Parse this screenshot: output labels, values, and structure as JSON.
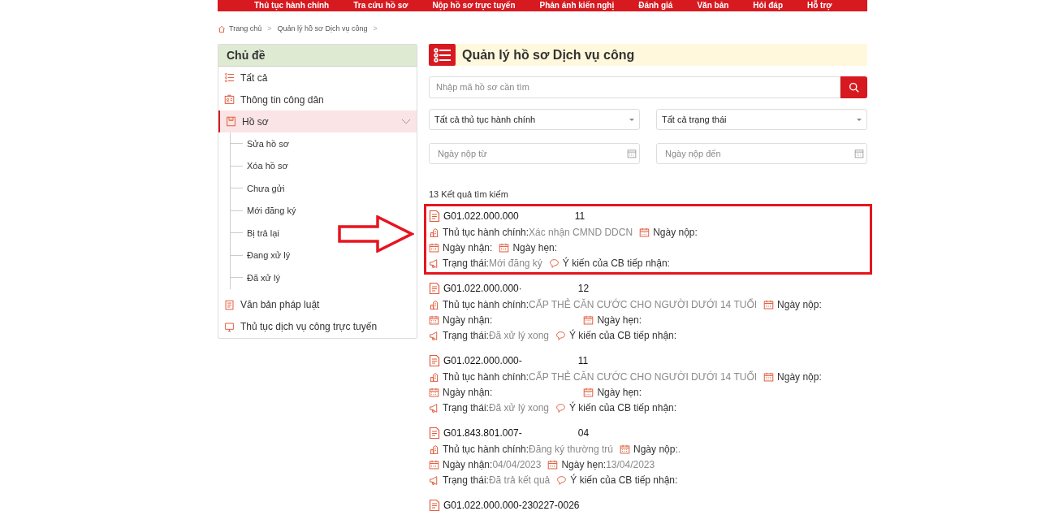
{
  "nav": [
    "Thủ tục hành chính",
    "Tra cứu hồ sơ",
    "Nộp hồ sơ trực tuyến",
    "Phản ánh kiến nghị",
    "Đánh giá",
    "Văn bản",
    "Hỏi đáp",
    "Hỗ trợ"
  ],
  "breadcrumb": [
    {
      "label": "Trang chủ",
      "separator": ">"
    },
    {
      "label": "Quản lý hồ sơ Dịch vụ công",
      "separator": ">"
    }
  ],
  "sidebar": {
    "title": "Chủ đề",
    "items": [
      {
        "label": "Tất cả",
        "selected": false
      },
      {
        "label": "Thông tin công dân",
        "selected": false
      },
      {
        "label": "Hồ sơ",
        "selected": true,
        "expanded": true,
        "children": [
          {
            "label": "Sửa hồ sơ"
          },
          {
            "label": "Xóa hồ sơ"
          },
          {
            "label": "Chưa gửi"
          },
          {
            "label": "Mới đăng ký"
          },
          {
            "label": "Bị trả lại"
          },
          {
            "label": "Đang xử lý"
          },
          {
            "label": "Đã xử lý"
          }
        ]
      },
      {
        "label": "Văn bản pháp luật",
        "selected": false
      },
      {
        "label": "Thủ tục dịch vụ công trực tuyến",
        "selected": false
      }
    ]
  },
  "page_title": "Quản lý hồ sơ Dịch vụ công",
  "search": {
    "placeholder": "Nhập mã hồ sơ cần tìm"
  },
  "filters": [
    {
      "kind": "select",
      "value": "Tất cả thủ tục hành chính"
    },
    {
      "kind": "select",
      "value": "Tất cả trạng thái"
    },
    {
      "kind": "date",
      "placeholder": "Ngày nộp từ"
    },
    {
      "kind": "date",
      "placeholder": "Ngày nộp đến"
    }
  ],
  "result_count": "13 Kết quả tìm kiếm",
  "records": [
    {
      "code": "G01.022.000.000",
      "suffix": "11",
      "highlighted": true,
      "lines": [
        [
          {
            "label": "Thủ tục hành chính:",
            "value": "Xác nhận CMND DDCN"
          },
          {
            "label": "Ngày nộp:"
          }
        ],
        [
          {
            "label": "Ngày nhận:",
            "redacted": false
          },
          {
            "label": "Ngày hẹn:"
          }
        ],
        [
          {
            "label": "Trạng thái:",
            "value": "Mới đăng ký"
          },
          {
            "label": "Ý kiến của CB tiếp nhận:"
          }
        ]
      ]
    },
    {
      "code": "G01.022.000.000·",
      "suffix": "12",
      "lines": [
        [
          {
            "label": "Thủ tục hành chính:",
            "value": "CẤP THẺ CĂN CƯỚC CHO NGƯỜI DƯỚI 14 TUỔI"
          },
          {
            "label": "Ngày nộp:"
          }
        ],
        [
          {
            "label": "Ngày nhận:",
            "redacted": true
          },
          {
            "label": "Ngày hẹn:"
          }
        ],
        [
          {
            "label": "Trạng thái:",
            "value": "Đã xử lý xong"
          },
          {
            "label": "Ý kiến của CB tiếp nhận:"
          }
        ]
      ]
    },
    {
      "code": "G01.022.000.000-",
      "suffix": "11",
      "lines": [
        [
          {
            "label": "Thủ tục hành chính:",
            "value": "CẤP THẺ CĂN CƯỚC CHO NGƯỜI DƯỚI 14 TUỔI"
          },
          {
            "label": "Ngày nộp:"
          }
        ],
        [
          {
            "label": "Ngày nhận:",
            "redacted": true
          },
          {
            "label": "Ngày hẹn:"
          }
        ],
        [
          {
            "label": "Trạng thái:",
            "value": "Đã xử lý xong"
          },
          {
            "label": "Ý kiến của CB tiếp nhận:"
          }
        ]
      ]
    },
    {
      "code": "G01.843.801.007-",
      "suffix": "04",
      "lines": [
        [
          {
            "label": "Thủ tục hành chính:",
            "value": "Đăng ký thường trú"
          },
          {
            "label": "Ngày nộp:",
            "value": "."
          }
        ],
        [
          {
            "label": "Ngày nhận:",
            "value": "04/04/2023",
            "redacted": false
          },
          {
            "label": "Ngày hẹn:",
            "value": "13/04/2023"
          }
        ],
        [
          {
            "label": "Trạng thái:",
            "value": "Đã trả kết quả"
          },
          {
            "label": "Ý kiến của CB tiếp nhận:"
          }
        ]
      ]
    },
    {
      "code": "G01.022.000.000-230227-0026"
    }
  ]
}
